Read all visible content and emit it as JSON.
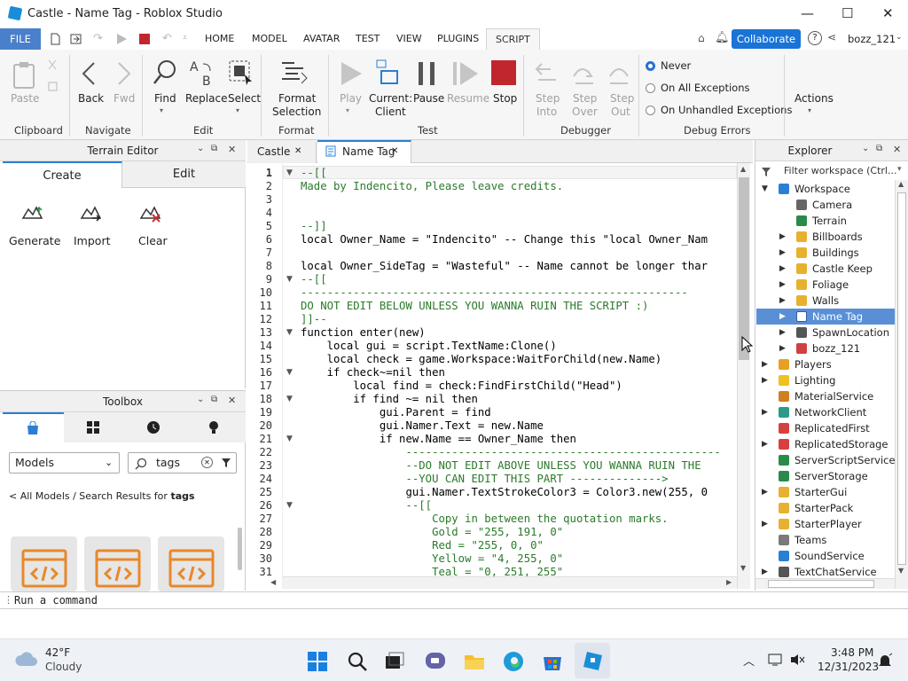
{
  "window": {
    "title": "Castle - Name Tag - Roblox Studio",
    "minimize": "—",
    "maximize": "☐",
    "close": "✕"
  },
  "menu": {
    "file": "FILE",
    "tabs": [
      "HOME",
      "MODEL",
      "AVATAR",
      "TEST",
      "VIEW",
      "PLUGINS",
      "SCRIPT"
    ],
    "active_tab": "SCRIPT",
    "collaborate": "Collaborate",
    "user": "bozz_121"
  },
  "ribbon": {
    "clipboard": {
      "paste": "Paste",
      "group": "Clipboard"
    },
    "navigate": {
      "back": "Back",
      "fwd": "Fwd",
      "group": "Navigate"
    },
    "edit": {
      "find": "Find",
      "replace": "Replace",
      "select": "Select",
      "group": "Edit"
    },
    "format": {
      "line1": "Format",
      "line2": "Selection",
      "group": "Format"
    },
    "test": {
      "play": "Play",
      "current1": "Current:",
      "current2": "Client",
      "pause": "Pause",
      "resume": "Resume",
      "stop": "Stop",
      "group": "Test"
    },
    "debugger": {
      "step_into1": "Step",
      "step_into2": "Into",
      "step_over1": "Step",
      "step_over2": "Over",
      "step_out1": "Step",
      "step_out2": "Out",
      "group": "Debugger"
    },
    "debug_errors": {
      "never": "Never",
      "on_all": "On All Exceptions",
      "on_unhandled": "On Unhandled Exceptions",
      "group": "Debug Errors"
    },
    "actions": {
      "label": "Actions"
    }
  },
  "terrain": {
    "title": "Terrain Editor",
    "tab_create": "Create",
    "tab_edit": "Edit",
    "generate": "Generate",
    "import": "Import",
    "clear": "Clear"
  },
  "toolbox": {
    "title": "Toolbox",
    "category": "Models",
    "search": "tags",
    "breadcrumb_prefix": "< All Models / Search Results for ",
    "breadcrumb_term": "tags"
  },
  "editor_tabs": {
    "castle": "Castle",
    "nametag": "Name Tag"
  },
  "code": {
    "line_numbers": [
      "1",
      "2",
      "3",
      "4",
      "5",
      "6",
      "7",
      "8",
      "9",
      "10",
      "11",
      "12",
      "13",
      "14",
      "15",
      "16",
      "17",
      "18",
      "19",
      "20",
      "21",
      "22",
      "23",
      "24",
      "25",
      "26",
      "27",
      "28",
      "29",
      "30",
      "31"
    ],
    "lines": [
      "--[[",
      "Made by Indencito, Please leave credits.",
      "",
      "",
      "--]]",
      "local Owner_Name = \"Indencito\" -- Change this \"local Owner_Nam",
      "",
      "local Owner_SideTag = \"Wasteful\" -- Name cannot be longer thar",
      "--[[",
      "-----------------------------------------------------------",
      "DO NOT EDIT BELOW UNLESS YOU WANNA RUIN THE SCRIPT :)",
      "]]--",
      "function enter(new)",
      "    local gui = script.TextName:Clone()",
      "    local check = game.Workspace:WaitForChild(new.Name)",
      "    if check~=nil then",
      "        local find = check:FindFirstChild(\"Head\")",
      "        if find ~= nil then",
      "            gui.Parent = find",
      "            gui.Namer.Text = new.Name",
      "            if new.Name == Owner_Name then",
      "                ------------------------------------------------",
      "                --DO NOT EDIT ABOVE UNLESS YOU WANNA RUIN THE",
      "                --YOU CAN EDIT THIS PART -------------->",
      "                gui.Namer.TextStrokeColor3 = Color3.new(255, 0",
      "                --[[",
      "                    Copy in between the quotation marks.",
      "                    Gold = \"255, 191, 0\"",
      "                    Red = \"255, 0, 0\"",
      "                    Yellow = \"4, 255, 0\"",
      "                    Teal = \"0, 251, 255\""
    ]
  },
  "explorer": {
    "title": "Explorer",
    "filter": "Filter workspace (Ctrl...",
    "items": [
      {
        "label": "Workspace",
        "icon": "globe-icon",
        "color": "#2a7fd4"
      },
      {
        "label": "Camera",
        "icon": "camera-icon",
        "color": "#666666"
      },
      {
        "label": "Terrain",
        "icon": "terrain-icon",
        "color": "#2a8a4a"
      },
      {
        "label": "Billboards",
        "icon": "folder-icon",
        "color": "#e8b030"
      },
      {
        "label": "Buildings",
        "icon": "folder-icon",
        "color": "#e8b030"
      },
      {
        "label": "Castle Keep",
        "icon": "folder-icon",
        "color": "#e8b030"
      },
      {
        "label": "Foliage",
        "icon": "folder-icon",
        "color": "#e8b030"
      },
      {
        "label": "Walls",
        "icon": "folder-icon",
        "color": "#e8b030"
      },
      {
        "label": "Name Tag",
        "icon": "script-icon",
        "color": "#ffffff"
      },
      {
        "label": "SpawnLocation",
        "icon": "spawn-icon",
        "color": "#555555"
      },
      {
        "label": "bozz_121",
        "icon": "model-icon",
        "color": "#d04040"
      },
      {
        "label": "Players",
        "icon": "players-icon",
        "color": "#e8a020"
      },
      {
        "label": "Lighting",
        "icon": "lighting-icon",
        "color": "#f0c020"
      },
      {
        "label": "MaterialService",
        "icon": "material-icon",
        "color": "#d08020"
      },
      {
        "label": "NetworkClient",
        "icon": "network-icon",
        "color": "#2a9a8a"
      },
      {
        "label": "ReplicatedFirst",
        "icon": "replicated-icon",
        "color": "#d84040"
      },
      {
        "label": "ReplicatedStorage",
        "icon": "storage-icon",
        "color": "#d84040"
      },
      {
        "label": "ServerScriptService",
        "icon": "server-script-icon",
        "color": "#2a8a4a"
      },
      {
        "label": "ServerStorage",
        "icon": "server-storage-icon",
        "color": "#2a8a4a"
      },
      {
        "label": "StarterGui",
        "icon": "startergui-icon",
        "color": "#e8b030"
      },
      {
        "label": "StarterPack",
        "icon": "starterpack-icon",
        "color": "#e8b030"
      },
      {
        "label": "StarterPlayer",
        "icon": "starterplayer-icon",
        "color": "#e8b030"
      },
      {
        "label": "Teams",
        "icon": "teams-icon",
        "color": "#7a7a7a"
      },
      {
        "label": "SoundService",
        "icon": "sound-icon",
        "color": "#2a7fd4"
      },
      {
        "label": "TextChatService",
        "icon": "chat-icon",
        "color": "#555555"
      }
    ]
  },
  "command": {
    "placeholder": "Run a command"
  },
  "taskbar": {
    "temp": "42°F",
    "weather": "Cloudy",
    "time": "3:48 PM",
    "date": "12/31/2023"
  }
}
